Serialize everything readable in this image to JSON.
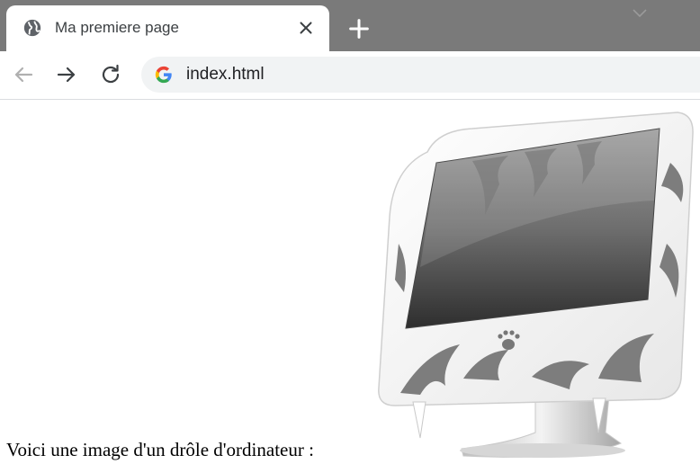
{
  "browser": {
    "tab": {
      "title": "Ma premiere page",
      "favicon": "globe-icon",
      "close_icon": "close-icon"
    },
    "new_tab_icon": "plus-icon",
    "nav": {
      "back_icon": "arrow-left-icon",
      "forward_icon": "arrow-right-icon",
      "reload_icon": "reload-icon"
    },
    "address_bar": {
      "url": "index.html",
      "icon": "google-g-icon"
    }
  },
  "page": {
    "caption": "Voici une image d'un drôle d'ordinateur :",
    "image": {
      "subject": "computer-illustration-icon"
    }
  },
  "colors": {
    "titlebar": "#7a7a7a",
    "tab_bg": "#ffffff",
    "omnibox_bg": "#f1f3f4"
  }
}
